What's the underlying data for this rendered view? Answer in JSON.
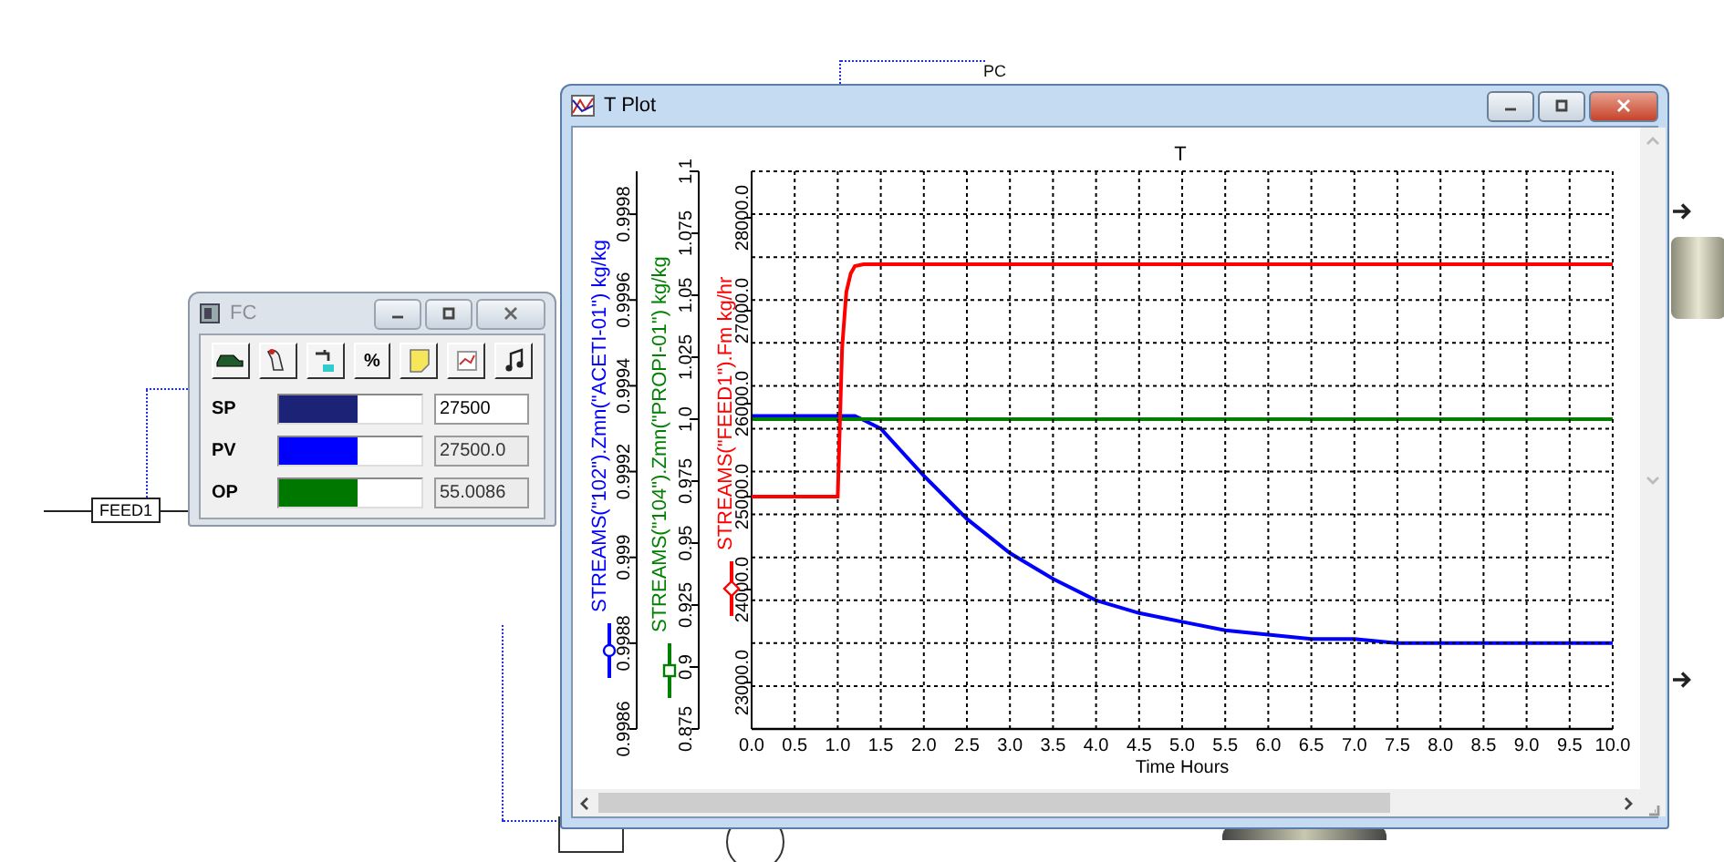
{
  "flowsheet": {
    "stream_label": "FEED1",
    "tag_label": "PC"
  },
  "faceplate": {
    "title": "FC",
    "active": false,
    "percent_label": "%",
    "rows": [
      {
        "label": "SP",
        "level": 0.55,
        "color": "#1c2275",
        "value": "27500",
        "editable": true
      },
      {
        "label": "PV",
        "level": 0.55,
        "color": "#0000ff",
        "value": "27500.0",
        "editable": false
      },
      {
        "label": "OP",
        "level": 0.55,
        "color": "#007800",
        "value": "55.0086",
        "editable": false
      }
    ]
  },
  "plot_window": {
    "title": "T Plot",
    "active": true,
    "plots": [
      {
        "chart_data": {
          "type": "line",
          "ylabel": "STREAMS(\"102\").Zmn(\"ACETI-01\") kg/kg",
          "xlim": [
            0,
            10
          ],
          "ylim": [
            0.9986,
            0.9999
          ],
          "yticks": [
            0.9986,
            0.9988,
            0.999,
            0.9992,
            0.9994,
            0.9996,
            0.9998
          ],
          "x": [
            0,
            0.5,
            1,
            1.05,
            1.1,
            1.15,
            1.2,
            1.3,
            1.5,
            2,
            2.5,
            3,
            3.5,
            4,
            4.5,
            5,
            5.5,
            6,
            6.5,
            7,
            7.5,
            8,
            8.5,
            9,
            9.5,
            10
          ],
          "series": [
            {
              "color": "#0000ff",
              "values": [
                0.99933,
                0.99933,
                0.99933,
                0.99933,
                0.99933,
                0.99933,
                0.99933,
                0.99932,
                0.9993,
                0.99919,
                0.99909,
                0.99901,
                0.99895,
                0.9989,
                0.99887,
                0.99885,
                0.99883,
                0.99882,
                0.99881,
                0.99881,
                0.9988,
                0.9988,
                0.9988,
                0.9988,
                0.9988,
                0.9988
              ]
            }
          ]
        }
      },
      {
        "chart_data": {
          "type": "line",
          "ylabel": "STREAMS(\"104\").Zmn(\"PROPI-01\") kg/kg",
          "xlim": [
            0,
            10
          ],
          "ylim": [
            0.875,
            1.1
          ],
          "yticks": [
            0.875,
            0.9,
            0.925,
            0.95,
            0.975,
            {
              "value": 1,
              "label": "1.0"
            },
            1.025,
            1.05,
            1.075,
            1.1
          ],
          "x": [
            0,
            0.5,
            1,
            1.05,
            1.1,
            1.15,
            1.2,
            1.3,
            1.5,
            2,
            2.5,
            3,
            3.5,
            4,
            4.5,
            5,
            5.5,
            6,
            6.5,
            7,
            7.5,
            8,
            8.5,
            9,
            9.5,
            10
          ],
          "series": [
            {
              "color": "#008000",
              "values": [
                1,
                1,
                1,
                1,
                1,
                1,
                1,
                1,
                1,
                1,
                1,
                1,
                1,
                1,
                1,
                1,
                1,
                1,
                1,
                1,
                1,
                1,
                1,
                1,
                1,
                1
              ]
            }
          ]
        }
      },
      {
        "chart_data": {
          "type": "line",
          "title": "T",
          "xlabel": "Time Hours",
          "ylabel": "STREAMS(\"FEED1\").Fm kg/hr",
          "grid": true,
          "xlim": [
            0,
            10
          ],
          "ylim": [
            22500,
            28500
          ],
          "yticks": [
            {
              "value": 23000,
              "label": "23000.0"
            },
            {
              "value": 24000,
              "label": "24000.0"
            },
            {
              "value": 25000,
              "label": "25000.0"
            },
            {
              "value": 26000,
              "label": "26000.0"
            },
            {
              "value": 27000,
              "label": "27000.0"
            },
            {
              "value": 28000,
              "label": "28000.0"
            }
          ],
          "xticks": [
            {
              "value": 0,
              "label": "0.0"
            },
            0.5,
            {
              "value": 1,
              "label": "1.0"
            },
            1.5,
            {
              "value": 2,
              "label": "2.0"
            },
            2.5,
            {
              "value": 3,
              "label": "3.0"
            },
            3.5,
            {
              "value": 4,
              "label": "4.0"
            },
            4.5,
            {
              "value": 5,
              "label": "5.0"
            },
            5.5,
            {
              "value": 6,
              "label": "6.0"
            },
            6.5,
            {
              "value": 7,
              "label": "7.0"
            },
            7.5,
            {
              "value": 8,
              "label": "8.0"
            },
            8.5,
            {
              "value": 9,
              "label": "9.0"
            },
            9.5,
            {
              "value": 10,
              "label": "10.0"
            }
          ],
          "x": [
            0,
            0.5,
            1,
            1.05,
            1.1,
            1.15,
            1.2,
            1.3,
            1.5,
            2,
            2.5,
            3,
            3.5,
            4,
            4.5,
            5,
            5.5,
            6,
            6.5,
            7,
            7.5,
            8,
            8.5,
            9,
            9.5,
            10
          ],
          "series": [
            {
              "color": "#ff0000",
              "values": [
                25000,
                25000,
                25000,
                26600,
                27200,
                27400,
                27480,
                27500,
                27500,
                27500,
                27500,
                27500,
                27500,
                27500,
                27500,
                27500,
                27500,
                27500,
                27500,
                27500,
                27500,
                27500,
                27500,
                27500,
                27500,
                27500
              ]
            }
          ]
        }
      }
    ]
  }
}
